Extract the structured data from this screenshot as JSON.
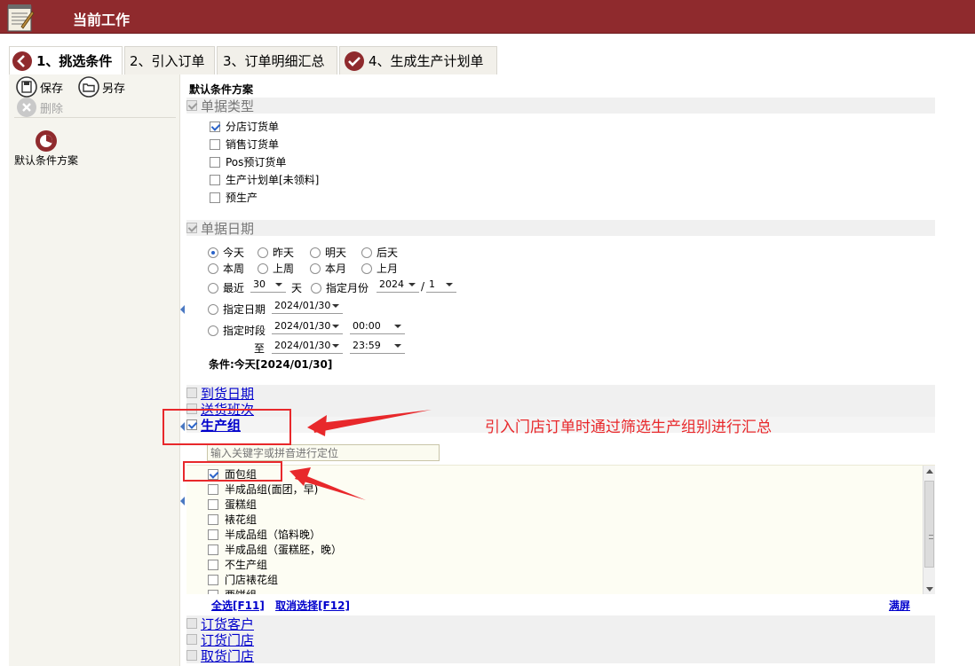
{
  "titlebar": {
    "title": "当前工作"
  },
  "tabs": [
    {
      "label": "1、挑选条件",
      "icon": "step-active-icon",
      "active": true
    },
    {
      "label": "2、引入订单",
      "active": false
    },
    {
      "label": "3、订单明细汇总",
      "active": false
    },
    {
      "label": "4、生成生产计划单",
      "icon": "check-circle-icon",
      "active": false
    }
  ],
  "toolbar": {
    "save_label": "保存",
    "save_as_label": "另存",
    "delete_label": "删除"
  },
  "schemes": [
    {
      "label": "默认条件方案",
      "icon": "scheme-icon"
    }
  ],
  "main": {
    "scheme_title": "默认条件方案",
    "doc_type": {
      "title": "单据类型",
      "checked": true,
      "options": [
        {
          "label": "分店订货单",
          "checked": true
        },
        {
          "label": "销售订货单",
          "checked": false
        },
        {
          "label": "Pos预订货单",
          "checked": false
        },
        {
          "label": "生产计划单[未领料]",
          "checked": false
        },
        {
          "label": "预生产",
          "checked": false
        }
      ]
    },
    "doc_date": {
      "title": "单据日期",
      "checked": true,
      "quick": [
        "今天",
        "昨天",
        "明天",
        "后天",
        "本周",
        "上周",
        "本月",
        "上月"
      ],
      "selected": "今天",
      "recent_label": "最近",
      "recent_value": "30",
      "days_label": "天",
      "month_label": "指定月份",
      "year_value": "2024",
      "slash": "/",
      "month_value": "1",
      "date_label": "指定日期",
      "date_value": "2024/01/30",
      "period_label": "指定时段",
      "period_start_date": "2024/01/30",
      "period_start_time": "00:00",
      "to_label": "至",
      "period_end_date": "2024/01/30",
      "period_end_time": "23:59",
      "condition_text": "条件:今天[2024/01/30]"
    },
    "arrival_date": {
      "title": "到货日期",
      "checked": false
    },
    "delivery_shift": {
      "title": "送货班次",
      "checked": false
    },
    "production_group": {
      "title": "生产组",
      "checked": true,
      "search_placeholder": "输入关键字或拼音进行定位",
      "items": [
        {
          "label": "面包组",
          "checked": true
        },
        {
          "label": "半成品组(面团，早)",
          "checked": false
        },
        {
          "label": "蛋糕组",
          "checked": false
        },
        {
          "label": "裱花组",
          "checked": false
        },
        {
          "label": "半成品组（馅料晚）",
          "checked": false
        },
        {
          "label": "半成品组（蛋糕胚，晚）",
          "checked": false
        },
        {
          "label": "不生产组",
          "checked": false
        },
        {
          "label": "门店裱花组",
          "checked": false
        },
        {
          "label": "西饼组",
          "checked": false
        }
      ],
      "select_all": "全选[F11]",
      "deselect": "取消选择[F12]",
      "fullscreen": "满屏"
    },
    "order_customer": {
      "title": "订货客户",
      "checked": false
    },
    "order_store": {
      "title": "订货门店",
      "checked": false
    },
    "pickup_store": {
      "title": "取货门店",
      "checked": false
    }
  },
  "annotation": {
    "text": "引入门店订单时通过筛选生产组别进行汇总",
    "color": "#e8282b"
  },
  "colors": {
    "titlebar": "#8f2a2d",
    "link": "#0000cc",
    "accent": "#2a63c9"
  }
}
